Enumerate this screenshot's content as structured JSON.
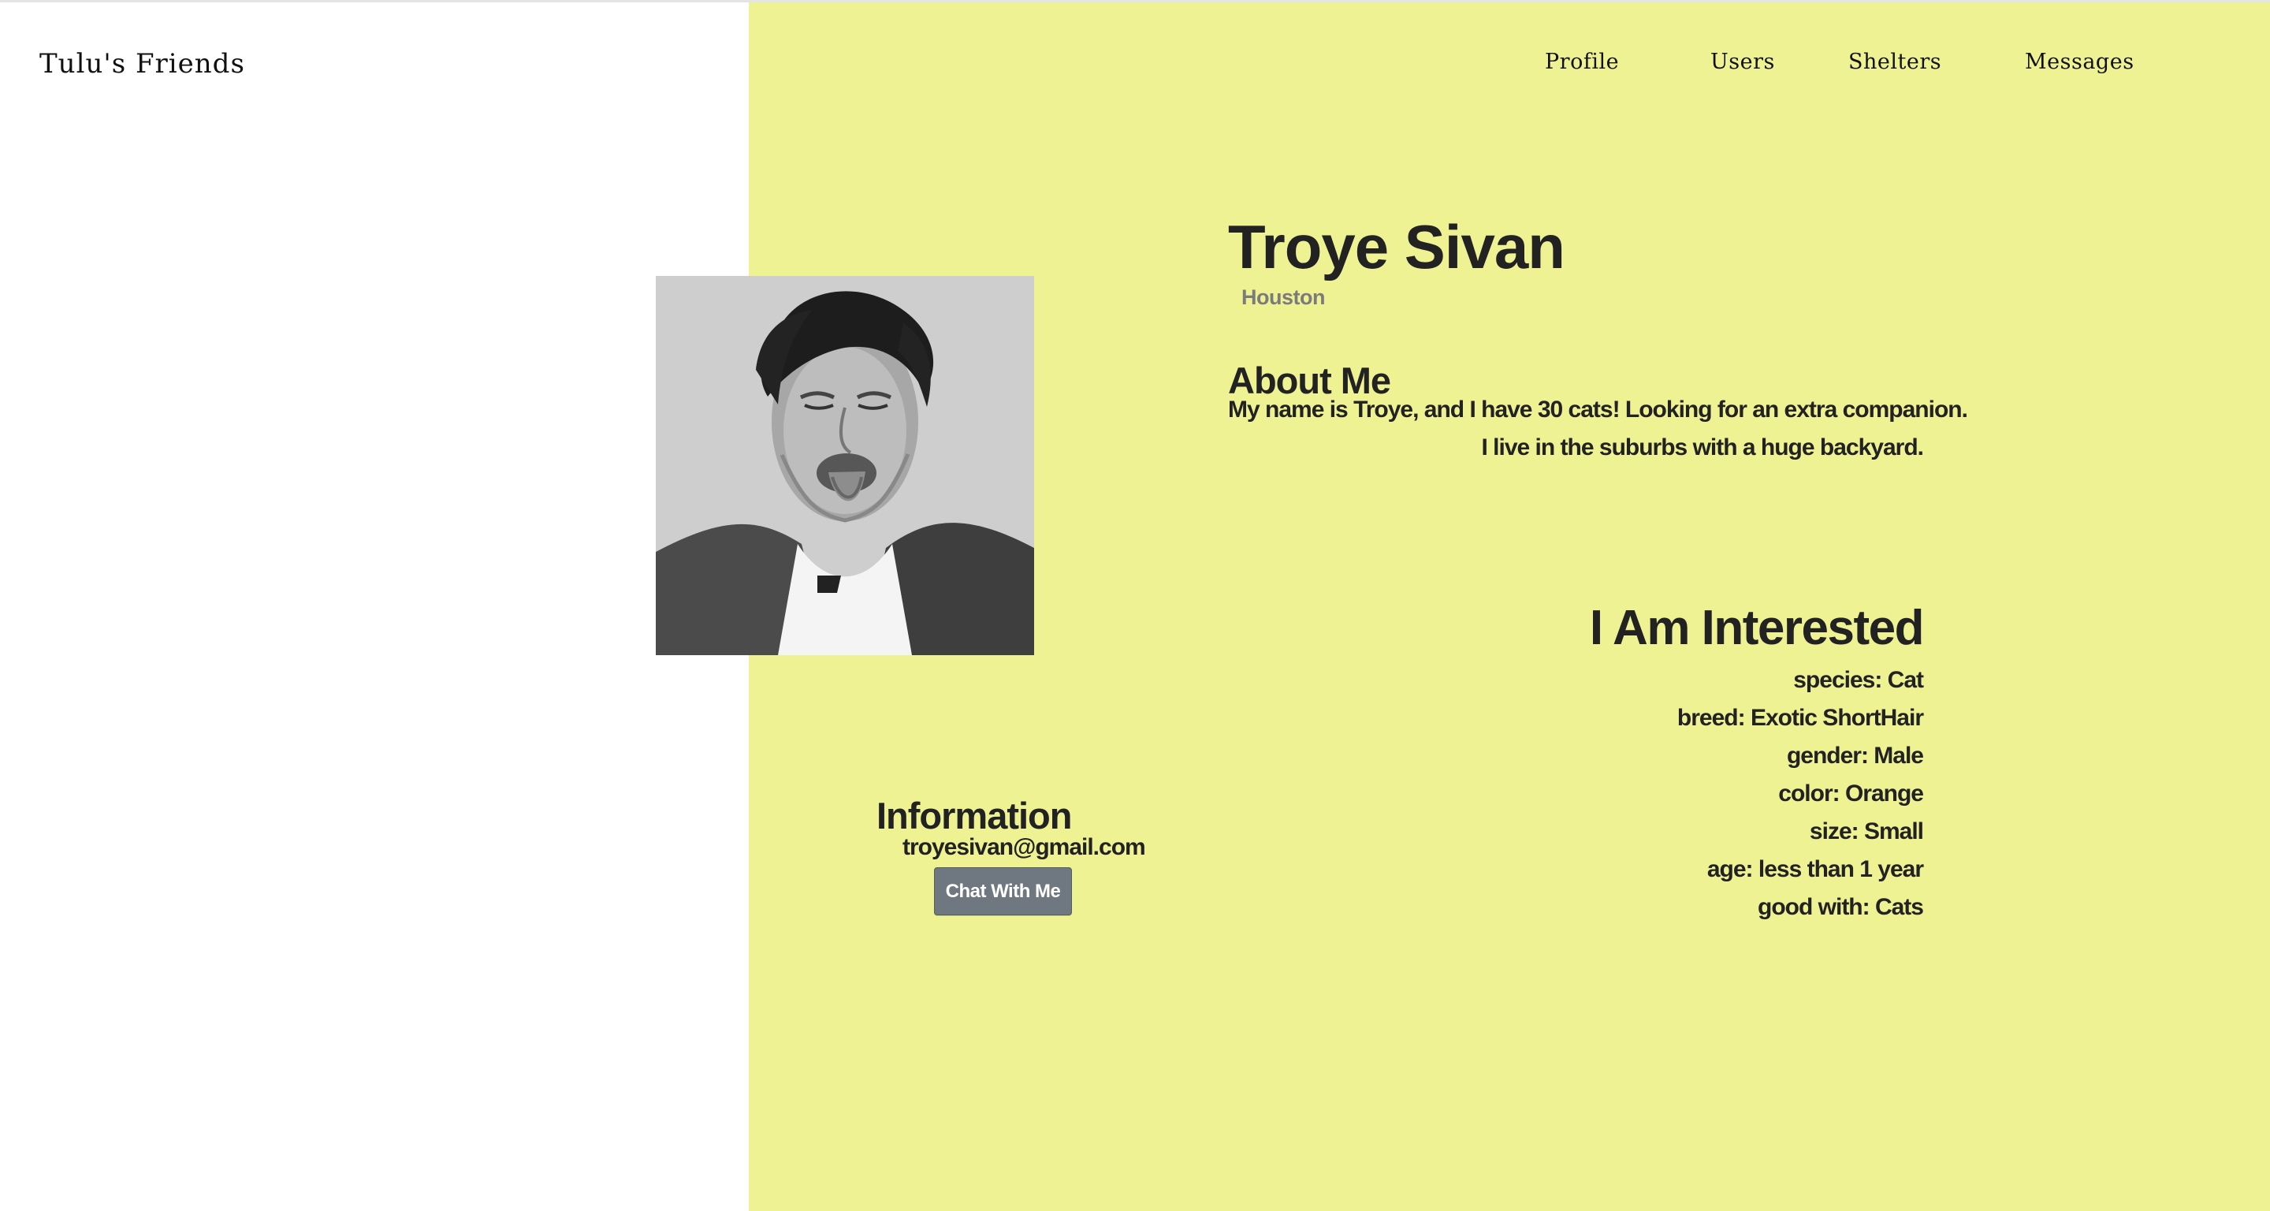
{
  "app": {
    "brand": "Tulu's Friends"
  },
  "nav": {
    "items": [
      {
        "label": "Profile"
      },
      {
        "label": "Users"
      },
      {
        "label": "Shelters"
      },
      {
        "label": "Messages"
      }
    ]
  },
  "profile": {
    "name": "Troye Sivan",
    "location": "Houston",
    "about": {
      "title": "About Me",
      "lines": [
        "My name is Troye, and I have 30 cats! Looking for an extra companion.",
        "I live in the suburbs with a huge backyard."
      ]
    },
    "interested": {
      "title": "I Am Interested",
      "items": [
        "species: Cat",
        "breed: Exotic ShortHair",
        "gender: Male",
        "color: Orange",
        "size: Small",
        "age: less than 1 year",
        "good with: Cats"
      ]
    },
    "information": {
      "title": "Information",
      "email": "troyesivan@gmail.com",
      "chat_button": "Chat With Me"
    },
    "avatar": {
      "alt": "profile photo"
    }
  },
  "colors": {
    "background_right": "#eff293",
    "text_primary": "#222222",
    "text_secondary": "#7b7b7b",
    "button": "#6f7780"
  }
}
